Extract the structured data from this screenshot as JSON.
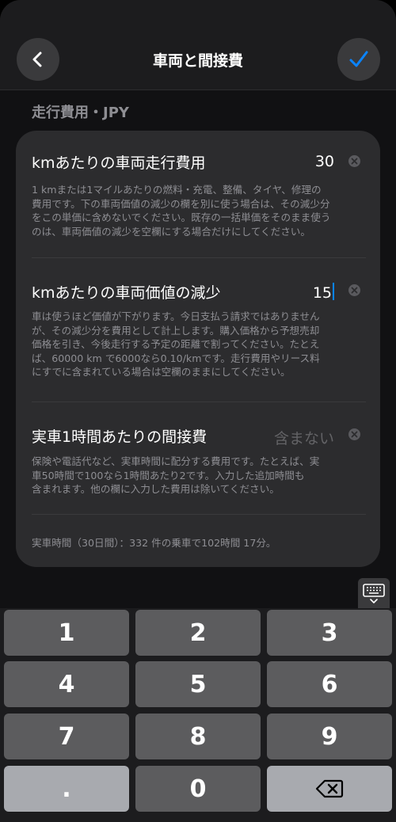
{
  "header": {
    "title": "車両と間接費",
    "back_icon": "chevron-left-icon",
    "done_icon": "checkmark-icon",
    "accent_color": "#0a84ff"
  },
  "section": {
    "label": "走行費用・JPY"
  },
  "rows": [
    {
      "title": "kmあたりの車両走行費用",
      "value": "30",
      "description": [
        "1 kmまたは1マイルあたりの燃料・充電、整備、タイヤ、修理の",
        "費用です。下の車両価値の減少の欄を別に使う場合は、その減少分",
        "をこの単価に含めないでください。既存の一括単価をそのまま使う",
        "のは、車両価値の減少を空欄にする場合だけにしてください。"
      ]
    },
    {
      "title": "kmあたりの車両価値の減少",
      "value": "15",
      "description": [
        "車は使うほど価値が下がります。今日支払う請求ではありません",
        "が、その減少分を費用として計上します。購入価格から予想売却",
        "価格を引き、今後走行する予定の距離で割ってください。たとえ",
        "ば、60000 km で6000なら0.10/kmです。走行費用やリース料",
        "にすでに含まれている場合は空欄のままにしてください。"
      ]
    },
    {
      "title": "実車1時間あたりの間接費",
      "placeholder": "含まない",
      "description": [
        "保険や電話代など、実車時間に配分する費用です。たとえば、実",
        "車50時間で100なら1時間あたり2です。入力した追加時間も",
        "含まれます。他の欄に入力した費用は除いてください。"
      ]
    }
  ],
  "footnote": "実車時間（30日間）：332 件の乗車で102時間 17分。",
  "keyboard": {
    "toggle_icon": "keyboard-dismiss-icon",
    "keys": [
      "1",
      "2",
      "3",
      "4",
      "5",
      "6",
      "7",
      "8",
      "9",
      ".",
      "0"
    ],
    "delete_icon": "delete-backspace-icon"
  }
}
